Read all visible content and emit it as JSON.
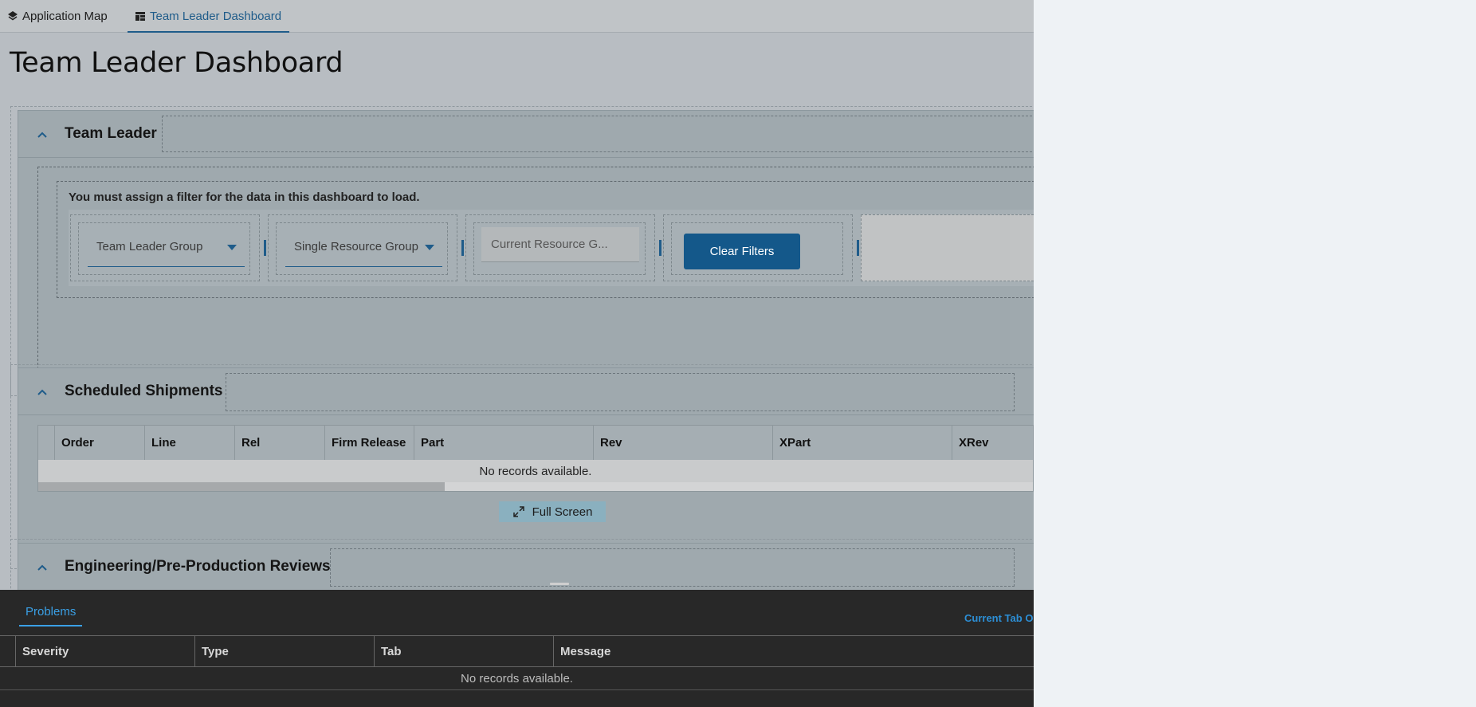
{
  "tabs": {
    "app_map": "Application Map",
    "dashboard": "Team Leader Dashboard"
  },
  "page": {
    "title": "Team Leader Dashboard"
  },
  "team_leader_card": {
    "title": "Team Leader",
    "notice": "You must assign a filter for the data in this dashboard to load.",
    "filters": {
      "team_leader_group": "Team Leader Group",
      "single_resource_group": "Single Resource Group",
      "current_resource_group": "Current Resource G..."
    },
    "clear_label": "Clear Filters"
  },
  "shipments_card": {
    "title": "Scheduled Shipments",
    "columns": [
      "Order",
      "Line",
      "Rel",
      "Firm Release",
      "Part",
      "Rev",
      "XPart",
      "XRev"
    ],
    "empty": "No records available.",
    "fullscreen_label": "Full Screen"
  },
  "reviews_card": {
    "title": "Engineering/Pre-Production Reviews"
  },
  "problems_panel": {
    "tab_label": "Problems",
    "scope_label": "Current Tab On",
    "columns": [
      "Severity",
      "Type",
      "Tab",
      "Message"
    ],
    "empty": "No records available."
  },
  "colors": {
    "accent": "#1f5c8a",
    "panel_tab": "#3aa0e6",
    "button": "#14588a"
  }
}
